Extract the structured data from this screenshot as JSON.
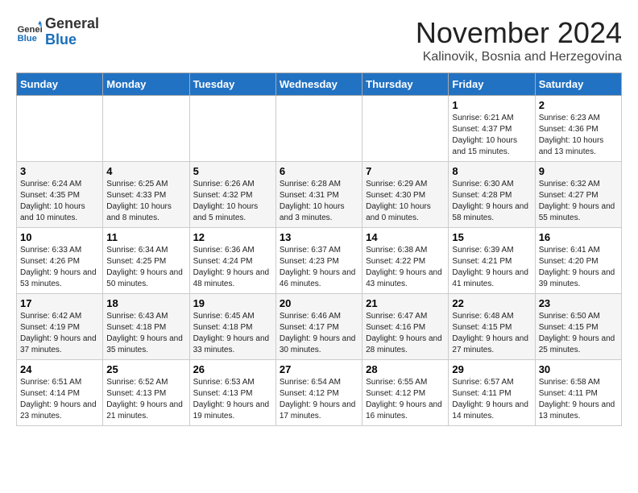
{
  "logo": {
    "general": "General",
    "blue": "Blue"
  },
  "title": "November 2024",
  "location": "Kalinovik, Bosnia and Herzegovina",
  "headers": [
    "Sunday",
    "Monday",
    "Tuesday",
    "Wednesday",
    "Thursday",
    "Friday",
    "Saturday"
  ],
  "weeks": [
    [
      {
        "day": "",
        "detail": ""
      },
      {
        "day": "",
        "detail": ""
      },
      {
        "day": "",
        "detail": ""
      },
      {
        "day": "",
        "detail": ""
      },
      {
        "day": "",
        "detail": ""
      },
      {
        "day": "1",
        "detail": "Sunrise: 6:21 AM\nSunset: 4:37 PM\nDaylight: 10 hours and 15 minutes."
      },
      {
        "day": "2",
        "detail": "Sunrise: 6:23 AM\nSunset: 4:36 PM\nDaylight: 10 hours and 13 minutes."
      }
    ],
    [
      {
        "day": "3",
        "detail": "Sunrise: 6:24 AM\nSunset: 4:35 PM\nDaylight: 10 hours and 10 minutes."
      },
      {
        "day": "4",
        "detail": "Sunrise: 6:25 AM\nSunset: 4:33 PM\nDaylight: 10 hours and 8 minutes."
      },
      {
        "day": "5",
        "detail": "Sunrise: 6:26 AM\nSunset: 4:32 PM\nDaylight: 10 hours and 5 minutes."
      },
      {
        "day": "6",
        "detail": "Sunrise: 6:28 AM\nSunset: 4:31 PM\nDaylight: 10 hours and 3 minutes."
      },
      {
        "day": "7",
        "detail": "Sunrise: 6:29 AM\nSunset: 4:30 PM\nDaylight: 10 hours and 0 minutes."
      },
      {
        "day": "8",
        "detail": "Sunrise: 6:30 AM\nSunset: 4:28 PM\nDaylight: 9 hours and 58 minutes."
      },
      {
        "day": "9",
        "detail": "Sunrise: 6:32 AM\nSunset: 4:27 PM\nDaylight: 9 hours and 55 minutes."
      }
    ],
    [
      {
        "day": "10",
        "detail": "Sunrise: 6:33 AM\nSunset: 4:26 PM\nDaylight: 9 hours and 53 minutes."
      },
      {
        "day": "11",
        "detail": "Sunrise: 6:34 AM\nSunset: 4:25 PM\nDaylight: 9 hours and 50 minutes."
      },
      {
        "day": "12",
        "detail": "Sunrise: 6:36 AM\nSunset: 4:24 PM\nDaylight: 9 hours and 48 minutes."
      },
      {
        "day": "13",
        "detail": "Sunrise: 6:37 AM\nSunset: 4:23 PM\nDaylight: 9 hours and 46 minutes."
      },
      {
        "day": "14",
        "detail": "Sunrise: 6:38 AM\nSunset: 4:22 PM\nDaylight: 9 hours and 43 minutes."
      },
      {
        "day": "15",
        "detail": "Sunrise: 6:39 AM\nSunset: 4:21 PM\nDaylight: 9 hours and 41 minutes."
      },
      {
        "day": "16",
        "detail": "Sunrise: 6:41 AM\nSunset: 4:20 PM\nDaylight: 9 hours and 39 minutes."
      }
    ],
    [
      {
        "day": "17",
        "detail": "Sunrise: 6:42 AM\nSunset: 4:19 PM\nDaylight: 9 hours and 37 minutes."
      },
      {
        "day": "18",
        "detail": "Sunrise: 6:43 AM\nSunset: 4:18 PM\nDaylight: 9 hours and 35 minutes."
      },
      {
        "day": "19",
        "detail": "Sunrise: 6:45 AM\nSunset: 4:18 PM\nDaylight: 9 hours and 33 minutes."
      },
      {
        "day": "20",
        "detail": "Sunrise: 6:46 AM\nSunset: 4:17 PM\nDaylight: 9 hours and 30 minutes."
      },
      {
        "day": "21",
        "detail": "Sunrise: 6:47 AM\nSunset: 4:16 PM\nDaylight: 9 hours and 28 minutes."
      },
      {
        "day": "22",
        "detail": "Sunrise: 6:48 AM\nSunset: 4:15 PM\nDaylight: 9 hours and 27 minutes."
      },
      {
        "day": "23",
        "detail": "Sunrise: 6:50 AM\nSunset: 4:15 PM\nDaylight: 9 hours and 25 minutes."
      }
    ],
    [
      {
        "day": "24",
        "detail": "Sunrise: 6:51 AM\nSunset: 4:14 PM\nDaylight: 9 hours and 23 minutes."
      },
      {
        "day": "25",
        "detail": "Sunrise: 6:52 AM\nSunset: 4:13 PM\nDaylight: 9 hours and 21 minutes."
      },
      {
        "day": "26",
        "detail": "Sunrise: 6:53 AM\nSunset: 4:13 PM\nDaylight: 9 hours and 19 minutes."
      },
      {
        "day": "27",
        "detail": "Sunrise: 6:54 AM\nSunset: 4:12 PM\nDaylight: 9 hours and 17 minutes."
      },
      {
        "day": "28",
        "detail": "Sunrise: 6:55 AM\nSunset: 4:12 PM\nDaylight: 9 hours and 16 minutes."
      },
      {
        "day": "29",
        "detail": "Sunrise: 6:57 AM\nSunset: 4:11 PM\nDaylight: 9 hours and 14 minutes."
      },
      {
        "day": "30",
        "detail": "Sunrise: 6:58 AM\nSunset: 4:11 PM\nDaylight: 9 hours and 13 minutes."
      }
    ]
  ]
}
